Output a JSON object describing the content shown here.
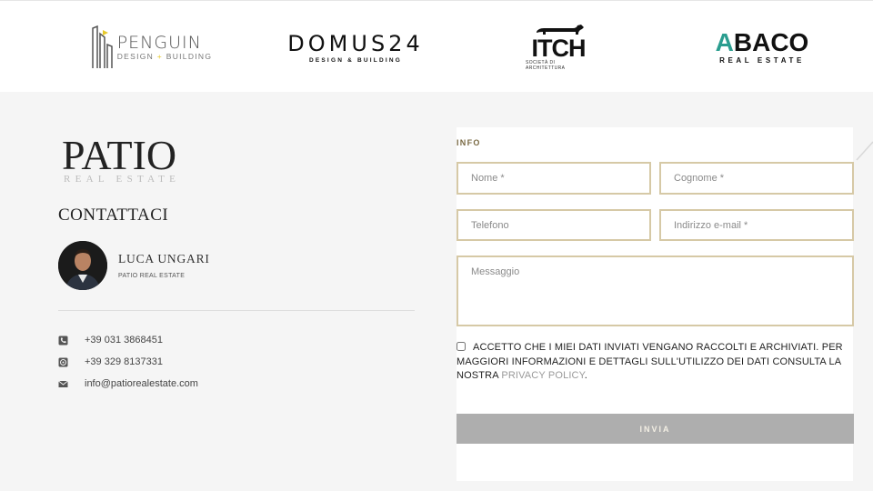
{
  "partners": {
    "penguin": {
      "name": "PENGUIN",
      "sub_left": "DESIGN",
      "sub_right": "BUILDING"
    },
    "domus": {
      "name": "DOMUS24",
      "sub": "DESIGN & BUILDING"
    },
    "itch": {
      "name": "ITCH",
      "sub": "SOCIETÀ DI ARCHITETTURA"
    },
    "abaco": {
      "name_a": "A",
      "name_rest": "BACO",
      "sub": "REAL ESTATE"
    }
  },
  "company": {
    "logo_name": "PATIO",
    "logo_sub": "REAL ESTATE"
  },
  "contact": {
    "title": "CONTATTACI",
    "agent": {
      "name": "LUCA UNGARI",
      "company": "PATIO REAL ESTATE"
    },
    "phone": "+39 031 3868451",
    "whatsapp": "+39 329 8137331",
    "email": "info@patiorealestate.com"
  },
  "form": {
    "section_label": "INFO",
    "placeholders": {
      "nome": "Nome *",
      "cognome": "Cognome *",
      "telefono": "Telefono",
      "email": "Indirizzo e-mail *",
      "messaggio": "Messaggio"
    },
    "consent_text": "ACCETTO CHE I MIEI DATI INVIATI VENGANO RACCOLTI E ARCHIVIATI. PER MAGGIORI INFORMAZIONI E DETTAGLI SULL'UTILIZZO DEI DATI CONSULTA LA NOSTRA ",
    "consent_link": "PRIVACY POLICY",
    "consent_end": ".",
    "submit_label": "INVIA"
  },
  "colors": {
    "accent_gold": "#d6c9a6",
    "label_brown": "#7a6a44",
    "button_grey": "#aeaeae",
    "teal": "#2a9d8f"
  }
}
